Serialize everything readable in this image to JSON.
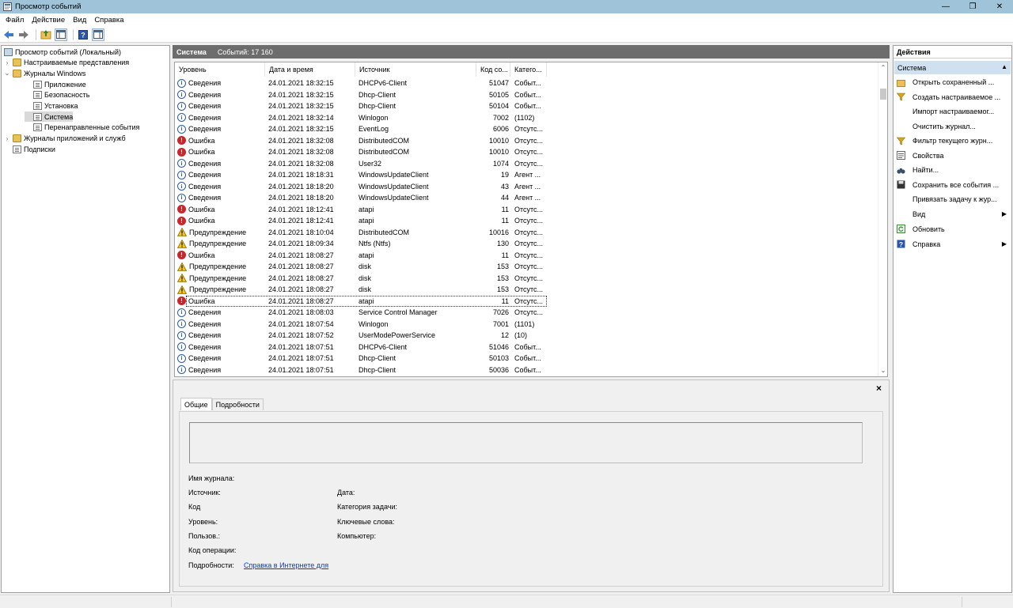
{
  "window": {
    "title": "Просмотр событий"
  },
  "menu": [
    "Файл",
    "Действие",
    "Вид",
    "Справка"
  ],
  "tree": [
    {
      "label": "Просмотр событий (Локальный)",
      "level": 0,
      "twisty": "",
      "icon": "root"
    },
    {
      "label": "Настраиваемые представления",
      "level": 1,
      "twisty": "›",
      "icon": "folder"
    },
    {
      "label": "Журналы Windows",
      "level": 1,
      "twisty": "⌄",
      "icon": "folder"
    },
    {
      "label": "Приложение",
      "level": 2,
      "twisty": "",
      "icon": "log"
    },
    {
      "label": "Безопасность",
      "level": 2,
      "twisty": "",
      "icon": "log"
    },
    {
      "label": "Установка",
      "level": 2,
      "twisty": "",
      "icon": "log"
    },
    {
      "label": "Система",
      "level": 2,
      "twisty": "",
      "icon": "log",
      "selected": true
    },
    {
      "label": "Перенаправленные события",
      "level": 2,
      "twisty": "",
      "icon": "log"
    },
    {
      "label": "Журналы приложений и служб",
      "level": 1,
      "twisty": "›",
      "icon": "folder"
    },
    {
      "label": "Подписки",
      "level": 1,
      "twisty": "",
      "icon": "log"
    }
  ],
  "center": {
    "title": "Система",
    "count": "Событий: 17 160"
  },
  "columns": [
    "Уровень",
    "Дата и время",
    "Источник",
    "Код со...",
    "Катего..."
  ],
  "rows": [
    {
      "type": "info",
      "level": "Сведения",
      "date": "24.01.2021 18:32:15",
      "source": "DHCPv6-Client",
      "code": "51047",
      "cat": "Событ..."
    },
    {
      "type": "info",
      "level": "Сведения",
      "date": "24.01.2021 18:32:15",
      "source": "Dhcp-Client",
      "code": "50105",
      "cat": "Событ..."
    },
    {
      "type": "info",
      "level": "Сведения",
      "date": "24.01.2021 18:32:15",
      "source": "Dhcp-Client",
      "code": "50104",
      "cat": "Событ..."
    },
    {
      "type": "info",
      "level": "Сведения",
      "date": "24.01.2021 18:32:14",
      "source": "Winlogon",
      "code": "7002",
      "cat": "(1102)"
    },
    {
      "type": "info",
      "level": "Сведения",
      "date": "24.01.2021 18:32:15",
      "source": "EventLog",
      "code": "6006",
      "cat": "Отсутс..."
    },
    {
      "type": "error",
      "level": "Ошибка",
      "date": "24.01.2021 18:32:08",
      "source": "DistributedCOM",
      "code": "10010",
      "cat": "Отсутс..."
    },
    {
      "type": "error",
      "level": "Ошибка",
      "date": "24.01.2021 18:32:08",
      "source": "DistributedCOM",
      "code": "10010",
      "cat": "Отсутс..."
    },
    {
      "type": "info",
      "level": "Сведения",
      "date": "24.01.2021 18:32:08",
      "source": "User32",
      "code": "1074",
      "cat": "Отсутс..."
    },
    {
      "type": "info",
      "level": "Сведения",
      "date": "24.01.2021 18:18:31",
      "source": "WindowsUpdateClient",
      "code": "19",
      "cat": "Агент ..."
    },
    {
      "type": "info",
      "level": "Сведения",
      "date": "24.01.2021 18:18:20",
      "source": "WindowsUpdateClient",
      "code": "43",
      "cat": "Агент ..."
    },
    {
      "type": "info",
      "level": "Сведения",
      "date": "24.01.2021 18:18:20",
      "source": "WindowsUpdateClient",
      "code": "44",
      "cat": "Агент ..."
    },
    {
      "type": "error",
      "level": "Ошибка",
      "date": "24.01.2021 18:12:41",
      "source": "atapi",
      "code": "11",
      "cat": "Отсутс..."
    },
    {
      "type": "error",
      "level": "Ошибка",
      "date": "24.01.2021 18:12:41",
      "source": "atapi",
      "code": "11",
      "cat": "Отсутс..."
    },
    {
      "type": "warn",
      "level": "Предупреждение",
      "date": "24.01.2021 18:10:04",
      "source": "DistributedCOM",
      "code": "10016",
      "cat": "Отсутс..."
    },
    {
      "type": "warn",
      "level": "Предупреждение",
      "date": "24.01.2021 18:09:34",
      "source": "Ntfs (Ntfs)",
      "code": "130",
      "cat": "Отсутс..."
    },
    {
      "type": "error",
      "level": "Ошибка",
      "date": "24.01.2021 18:08:27",
      "source": "atapi",
      "code": "11",
      "cat": "Отсутс..."
    },
    {
      "type": "warn",
      "level": "Предупреждение",
      "date": "24.01.2021 18:08:27",
      "source": "disk",
      "code": "153",
      "cat": "Отсутс..."
    },
    {
      "type": "warn",
      "level": "Предупреждение",
      "date": "24.01.2021 18:08:27",
      "source": "disk",
      "code": "153",
      "cat": "Отсутс..."
    },
    {
      "type": "warn",
      "level": "Предупреждение",
      "date": "24.01.2021 18:08:27",
      "source": "disk",
      "code": "153",
      "cat": "Отсутс..."
    },
    {
      "type": "error",
      "level": "Ошибка",
      "date": "24.01.2021 18:08:27",
      "source": "atapi",
      "code": "11",
      "cat": "Отсутс...",
      "focused": true
    },
    {
      "type": "info",
      "level": "Сведения",
      "date": "24.01.2021 18:08:03",
      "source": "Service Control Manager",
      "code": "7026",
      "cat": "Отсутс..."
    },
    {
      "type": "info",
      "level": "Сведения",
      "date": "24.01.2021 18:07:54",
      "source": "Winlogon",
      "code": "7001",
      "cat": "(1101)"
    },
    {
      "type": "info",
      "level": "Сведения",
      "date": "24.01.2021 18:07:52",
      "source": "UserModePowerService",
      "code": "12",
      "cat": "(10)"
    },
    {
      "type": "info",
      "level": "Сведения",
      "date": "24.01.2021 18:07:51",
      "source": "DHCPv6-Client",
      "code": "51046",
      "cat": "Событ..."
    },
    {
      "type": "info",
      "level": "Сведения",
      "date": "24.01.2021 18:07:51",
      "source": "Dhcp-Client",
      "code": "50103",
      "cat": "Событ..."
    },
    {
      "type": "info",
      "level": "Сведения",
      "date": "24.01.2021 18:07:51",
      "source": "Dhcp-Client",
      "code": "50036",
      "cat": "Событ..."
    }
  ],
  "detail": {
    "close": "×",
    "tabs": [
      "Общие",
      "Подробности"
    ],
    "fields": {
      "log_name": "Имя журнала:",
      "source": "Источник:",
      "date": "Дата:",
      "code": "Код",
      "task_category": "Категория задачи:",
      "level": "Уровень:",
      "keywords": "Ключевые слова:",
      "user": "Пользов.:",
      "computer": "Компьютер:",
      "opcode": "Код операции:",
      "more_info": "Подробности:",
      "help_link": "Справка в Интернете для "
    }
  },
  "actions": {
    "title": "Действия",
    "section": "Система",
    "items": [
      {
        "label": "Открыть сохраненный ...",
        "icon": "open-folder-icon",
        "sub": false
      },
      {
        "label": "Создать настраиваемое ...",
        "icon": "filter-icon",
        "sub": false
      },
      {
        "label": "Импорт настраиваемог...",
        "icon": "",
        "sub": false
      },
      {
        "label": "Очистить журнал...",
        "icon": "",
        "sub": false
      },
      {
        "label": "Фильтр текущего журн...",
        "icon": "filter-icon",
        "sub": false
      },
      {
        "label": "Свойства",
        "icon": "properties-icon",
        "sub": false
      },
      {
        "label": "Найти...",
        "icon": "binoculars-icon",
        "sub": false
      },
      {
        "label": "Сохранить все события ...",
        "icon": "save-icon",
        "sub": false
      },
      {
        "label": "Привязать задачу к жур...",
        "icon": "",
        "sub": false
      },
      {
        "label": "Вид",
        "icon": "",
        "sub": true
      },
      {
        "label": "Обновить",
        "icon": "refresh-icon",
        "sub": false
      },
      {
        "label": "Справка",
        "icon": "help-icon",
        "sub": true
      }
    ]
  }
}
